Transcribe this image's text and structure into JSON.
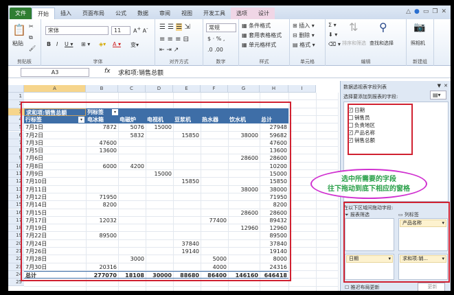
{
  "ribbon_tabs": [
    "文件",
    "开始",
    "插入",
    "页面布局",
    "公式",
    "数据",
    "审阅",
    "视图",
    "开发工具",
    "选项",
    "设计"
  ],
  "ribbon": {
    "paste": "粘贴",
    "clipboard": "剪贴板",
    "font_name": "宋体",
    "font_size": "11",
    "font_group": "字体",
    "align_group": "对齐方式",
    "number_format": "常规",
    "number_group": "数字",
    "cond_format": "条件格式",
    "table_format": "套用表格格式",
    "cell_styles": "单元格样式",
    "styles_group": "样式",
    "insert": "插入",
    "delete": "删除",
    "format": "格式",
    "cells_group": "单元格",
    "sort_filter": "排序和筛选",
    "find_select": "查找和选择",
    "editing_group": "编辑",
    "camera": "照相机",
    "new_group": "新建组"
  },
  "formula": {
    "name_box": "A3",
    "fx": "fx",
    "value": "求和项:销售总额"
  },
  "columns": [
    "A",
    "B",
    "C",
    "D",
    "E",
    "F",
    "G",
    "H",
    "I"
  ],
  "pivot": {
    "corner": "求和项:销售总额",
    "col_label": "列标签",
    "row_label": "行标签",
    "headers": [
      "电冰箱",
      "电磁炉",
      "电视机",
      "豆浆机",
      "热水器",
      "饮水机",
      "总计"
    ],
    "rows": [
      [
        "7月1日",
        "7872",
        "5076",
        "15000",
        "",
        "",
        "",
        "27948"
      ],
      [
        "7月2日",
        "",
        "5832",
        "",
        "15850",
        "",
        "38000",
        "59682"
      ],
      [
        "7月3日",
        "47600",
        "",
        "",
        "",
        "",
        "",
        "47600"
      ],
      [
        "7月5日",
        "13600",
        "",
        "",
        "",
        "",
        "",
        "13600"
      ],
      [
        "7月6日",
        "",
        "",
        "",
        "",
        "",
        "28600",
        "28600"
      ],
      [
        "7月8日",
        "6000",
        "4200",
        "",
        "",
        "",
        "",
        "10200"
      ],
      [
        "7月9日",
        "",
        "",
        "15000",
        "",
        "",
        "",
        "15000"
      ],
      [
        "7月10日",
        "",
        "",
        "",
        "15850",
        "",
        "",
        "15850"
      ],
      [
        "7月11日",
        "",
        "",
        "",
        "",
        "",
        "38000",
        "38000"
      ],
      [
        "7月12日",
        "71950",
        "",
        "",
        "",
        "",
        "",
        "71950"
      ],
      [
        "7月14日",
        "8200",
        "",
        "",
        "",
        "",
        "",
        "8200"
      ],
      [
        "7月15日",
        "",
        "",
        "",
        "",
        "",
        "28600",
        "28600"
      ],
      [
        "7月17日",
        "12032",
        "",
        "",
        "",
        "77400",
        "",
        "89432"
      ],
      [
        "7月19日",
        "",
        "",
        "",
        "",
        "",
        "12960",
        "12960"
      ],
      [
        "7月22日",
        "89500",
        "",
        "",
        "",
        "",
        "",
        "89500"
      ],
      [
        "7月24日",
        "",
        "",
        "",
        "37840",
        "",
        "",
        "37840"
      ],
      [
        "7月26日",
        "",
        "",
        "",
        "19140",
        "",
        "",
        "19140"
      ],
      [
        "7月28日",
        "",
        "3000",
        "",
        "",
        "5000",
        "",
        "8000"
      ],
      [
        "7月30日",
        "20316",
        "",
        "",
        "",
        "4000",
        "",
        "24316"
      ]
    ],
    "total": [
      "总计",
      "277070",
      "18108",
      "30000",
      "88680",
      "86400",
      "146160",
      "646418"
    ]
  },
  "pane": {
    "title": "数据透视表字段列表",
    "choose": "选择要添加到报表的字段:",
    "fields": [
      {
        "label": "日期",
        "checked": true
      },
      {
        "label": "销售员",
        "checked": false
      },
      {
        "label": "负责地区",
        "checked": false
      },
      {
        "label": "产品名称",
        "checked": true
      },
      {
        "label": "销售总额",
        "checked": true
      }
    ],
    "drag_label": "在以下区域间拖动字段:",
    "report_filter": "报表筛选",
    "column_labels": "列标签",
    "col_field": "产品名称",
    "row_field": "日期",
    "value_field": "求和项:销...",
    "defer": "推迟布局更新",
    "update": "更新"
  },
  "annotation": {
    "line1": "选中所需要的字段",
    "line2": "往下拖动到底下相应的窗格"
  }
}
